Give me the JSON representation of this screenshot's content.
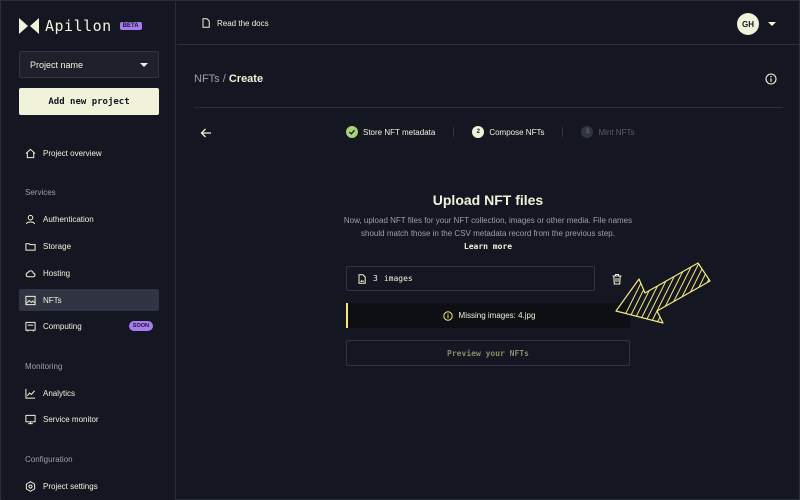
{
  "app": {
    "logo_text": "Apillon",
    "beta_label": "BETA"
  },
  "sidebar": {
    "project_select": "Project name",
    "add_project_label": "Add new project",
    "project_overview": "Project overview",
    "services_heading": "Services",
    "services": [
      {
        "label": "Authentication",
        "icon": "user-icon"
      },
      {
        "label": "Storage",
        "icon": "folder-icon"
      },
      {
        "label": "Hosting",
        "icon": "cloud-icon"
      },
      {
        "label": "NFTs",
        "icon": "image-icon",
        "active": true
      },
      {
        "label": "Computing",
        "icon": "chip-icon",
        "badge": "SOON"
      }
    ],
    "monitoring_heading": "Monitoring",
    "monitoring": [
      {
        "label": "Analytics",
        "icon": "chart-icon"
      },
      {
        "label": "Service monitor",
        "icon": "monitor-icon"
      }
    ],
    "configuration_heading": "Configuration",
    "configuration": [
      {
        "label": "Project settings",
        "icon": "settings-icon"
      }
    ]
  },
  "topbar": {
    "docs_label": "Read the docs",
    "avatar_initials": "GH"
  },
  "main": {
    "breadcrumb_parent": "NFTs /",
    "breadcrumb_current": "Create",
    "steps": [
      {
        "number": "1",
        "label": "Store NFT metadata",
        "state": "done"
      },
      {
        "number": "2",
        "label": "Compose NFTs",
        "state": "current"
      },
      {
        "number": "3",
        "label": "Mint NFTs",
        "state": "future"
      }
    ],
    "upload_title": "Upload NFT files",
    "upload_description": "Now, upload NFT files for your NFT collection, images or other media. File names should match those in the CSV metadata record from the previous step.",
    "learn_more": "Learn more",
    "file_count": "3",
    "file_type": "images",
    "warning_text": "Missing images: 4.jpg",
    "preview_button": "Preview your NFTs"
  },
  "colors": {
    "background": "#141721",
    "text": "#f0f2da",
    "muted": "#9d9eaa",
    "accent_purple": "#a67cf0",
    "warning_yellow": "#f7e97f",
    "done_green": "#a4d27a"
  }
}
